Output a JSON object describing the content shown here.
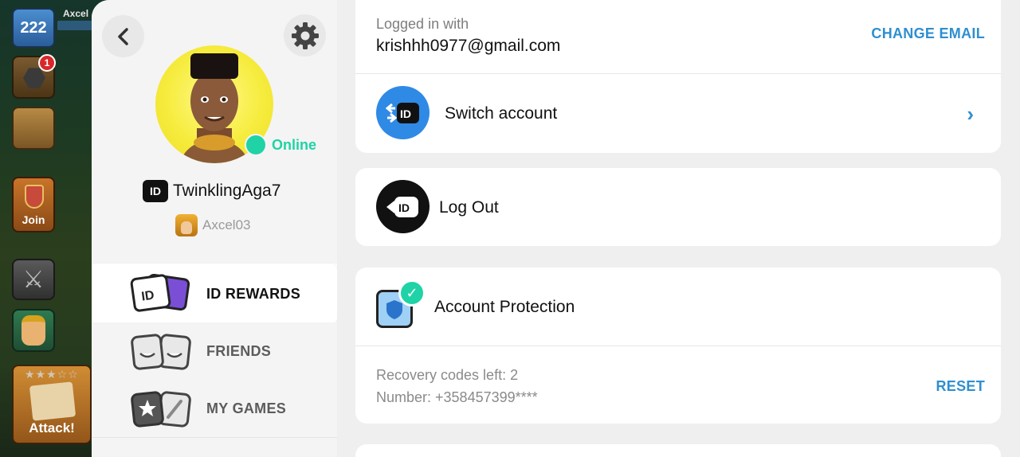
{
  "game": {
    "level": "222",
    "player_tag": "Axcel",
    "builder_notification": "1",
    "join_label": "Join",
    "attack_label": "Attack!"
  },
  "sidebar": {
    "online_status": "Online",
    "id_badge": "ID",
    "username": "TwinklingAga7",
    "player_name": "Axcel03",
    "nav": [
      {
        "label": "ID REWARDS",
        "active": true
      },
      {
        "label": "FRIENDS",
        "active": false
      },
      {
        "label": "MY GAMES",
        "active": false
      }
    ]
  },
  "account": {
    "logged_in_label": "Logged in with",
    "email": "krishhh0977@gmail.com",
    "change_email_label": "CHANGE EMAIL",
    "switch_account_label": "Switch account",
    "switch_icon_text": "ID"
  },
  "logout": {
    "label": "Log Out",
    "icon_text": "ID"
  },
  "protection": {
    "title": "Account Protection",
    "recovery_codes": "Recovery codes left: 2",
    "number": "Number: +358457399****",
    "reset_label": "RESET"
  },
  "colors": {
    "accent_blue": "#2f8fd0",
    "online_green": "#1fd3a6",
    "panel_bg": "#efefef"
  }
}
